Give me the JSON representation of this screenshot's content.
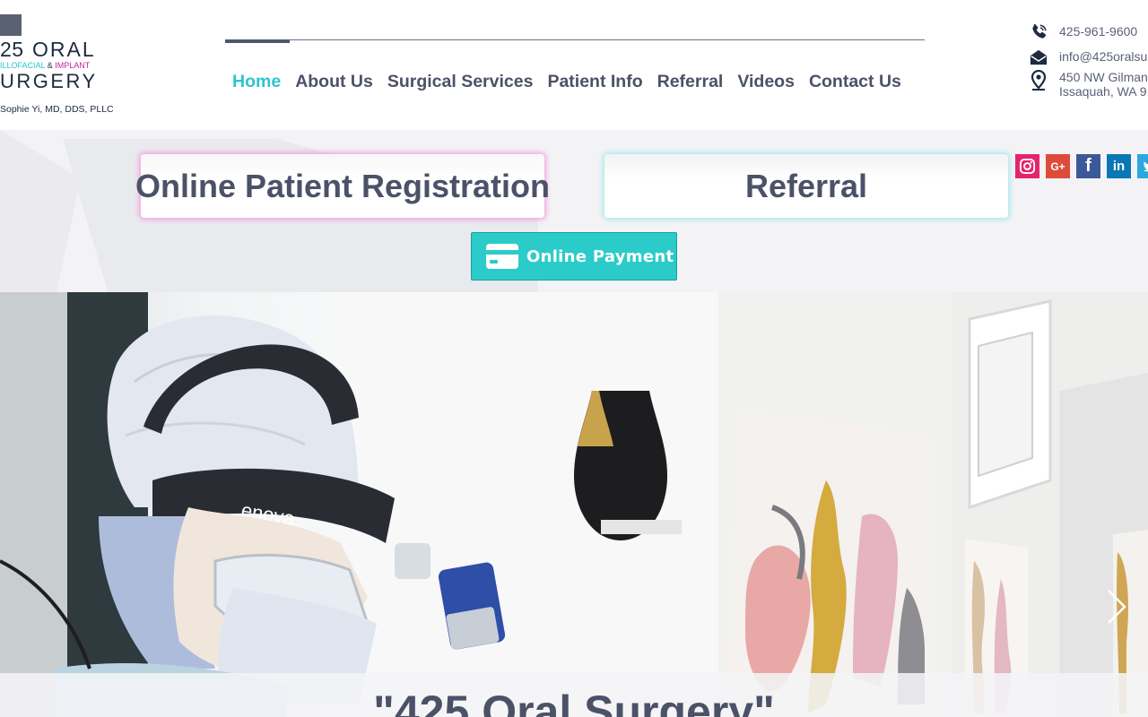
{
  "logo": {
    "number": "25",
    "word1": "ORAL",
    "tagline_a": "ILLOFACIAL",
    "tagline_b": " & ",
    "tagline_c": "IMPLANT",
    "word2": "URGERY",
    "doctor": "Sophie Yi, MD, DDS, PLLC"
  },
  "nav": {
    "items": [
      {
        "label": "Home",
        "active": true
      },
      {
        "label": "About Us"
      },
      {
        "label": "Surgical Services"
      },
      {
        "label": "Patient Info"
      },
      {
        "label": "Referral"
      },
      {
        "label": "Videos"
      },
      {
        "label": "Contact Us"
      }
    ]
  },
  "contact": {
    "phone": "425-961-9600",
    "email": "info@425oralsu",
    "address_line1": "450 NW Gilman",
    "address_line2": "Issaquah, WA 9",
    "icons": [
      "phone-icon",
      "envelope-icon",
      "map-pin-icon"
    ]
  },
  "actions": {
    "register_label": "Online Patient Registration",
    "referral_label": "Referral",
    "payment_label": "Online Payment"
  },
  "socials": [
    "instagram-icon",
    "google-plus-icon",
    "facebook-icon",
    "linkedin-icon",
    "twitter-icon"
  ],
  "social_glyphs": {
    "gp": "G+",
    "fb": "f",
    "li": "in"
  },
  "slideshow": {
    "caption": "\"425 Oral Surgery\"",
    "headlight_brand": "enova"
  },
  "colors": {
    "accent": "#2fc3ce",
    "nav_text": "#4b5268",
    "payment_bg": "#2bcbc9",
    "register_glow": "#f5a0e0",
    "referral_glow": "#a8e9ec"
  }
}
